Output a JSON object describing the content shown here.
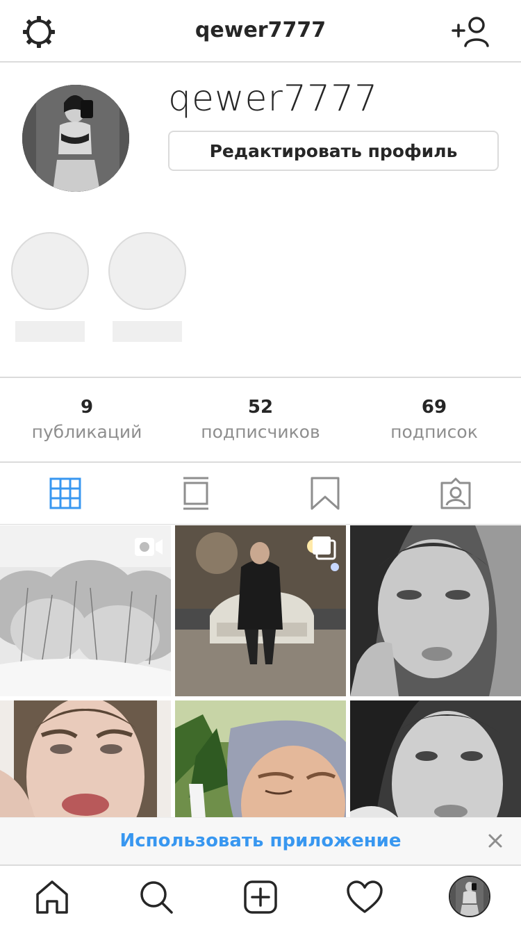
{
  "header": {
    "title": "qewer7777",
    "settings_icon": "gear-icon",
    "add_user_icon": "add-user-icon"
  },
  "profile": {
    "username": "qewer7777",
    "edit_button_label": "Редактировать профиль"
  },
  "stats": [
    {
      "value": "9",
      "label": "публикаций"
    },
    {
      "value": "52",
      "label": "подписчиков"
    },
    {
      "value": "69",
      "label": "подписок"
    }
  ],
  "tabs": [
    {
      "icon": "grid-icon",
      "active": true
    },
    {
      "icon": "feed-icon",
      "active": false
    },
    {
      "icon": "bookmark-icon",
      "active": false
    },
    {
      "icon": "tagged-icon",
      "active": false
    }
  ],
  "posts": [
    {
      "badge": "video-icon"
    },
    {
      "badge": "carousel-icon"
    },
    {
      "badge": ""
    },
    {
      "badge": ""
    },
    {
      "badge": ""
    },
    {
      "badge": ""
    }
  ],
  "banner": {
    "label": "Использовать приложение",
    "close_icon": "close-icon"
  },
  "bottom_nav": [
    "home-icon",
    "search-icon",
    "new-post-icon",
    "heart-icon",
    "profile-avatar"
  ],
  "colors": {
    "accent": "#3897f0",
    "text": "#262626",
    "secondary_text": "#8e8e8e",
    "border": "#dbdbdb"
  }
}
